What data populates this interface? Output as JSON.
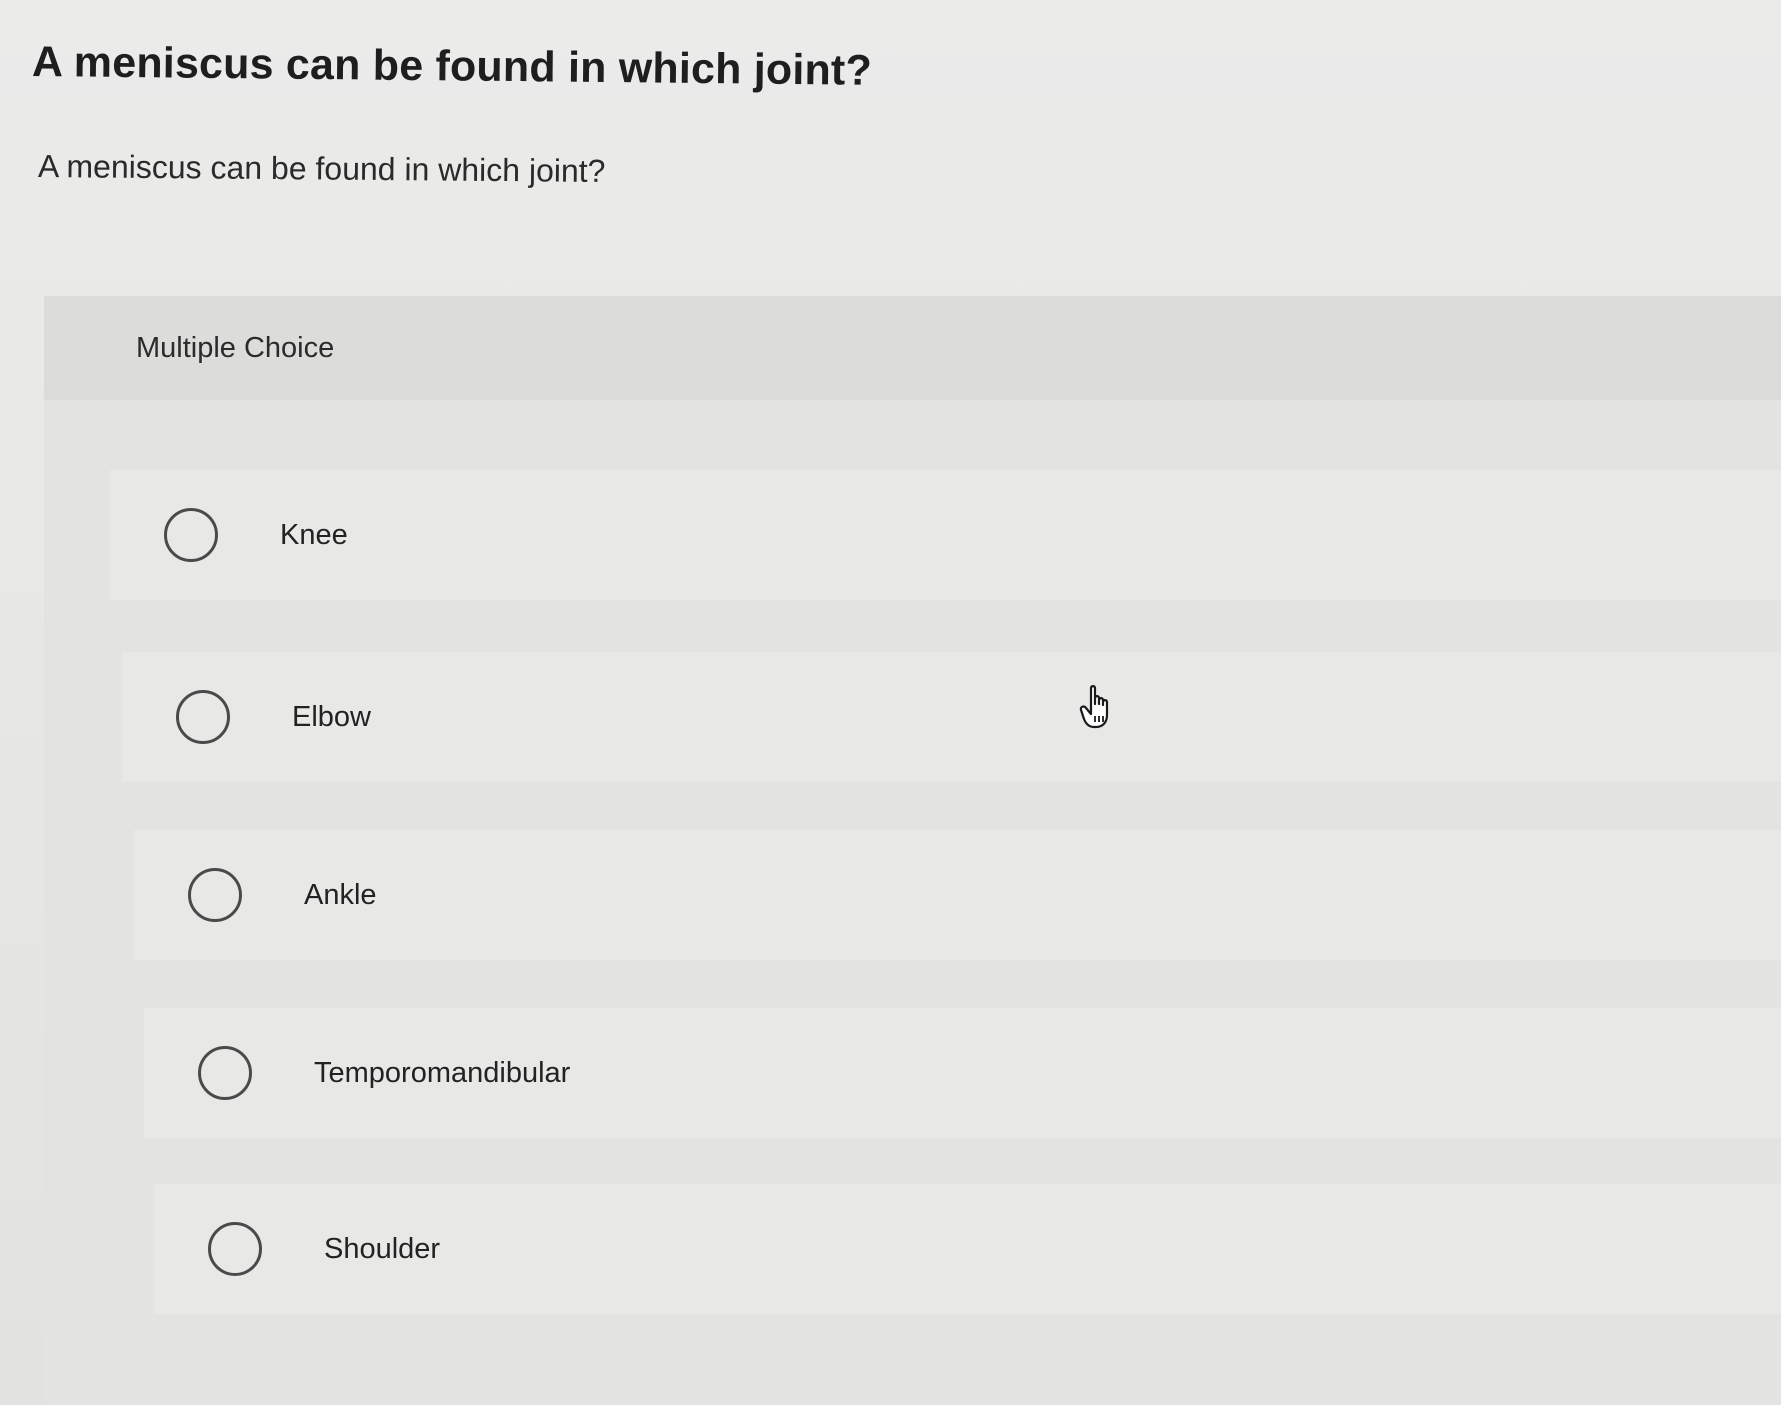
{
  "question": {
    "title": "A meniscus can be found in which joint?",
    "prompt": "A meniscus can be found in which joint?"
  },
  "question_type": {
    "label": "Multiple Choice"
  },
  "choices": [
    {
      "label": "Knee",
      "selected": false
    },
    {
      "label": "Elbow",
      "selected": false
    },
    {
      "label": "Ankle",
      "selected": false
    },
    {
      "label": "Temporomandibular",
      "selected": false
    },
    {
      "label": "Shoulder",
      "selected": false
    }
  ],
  "cursor": {
    "icon": "hand-pointer-icon"
  }
}
